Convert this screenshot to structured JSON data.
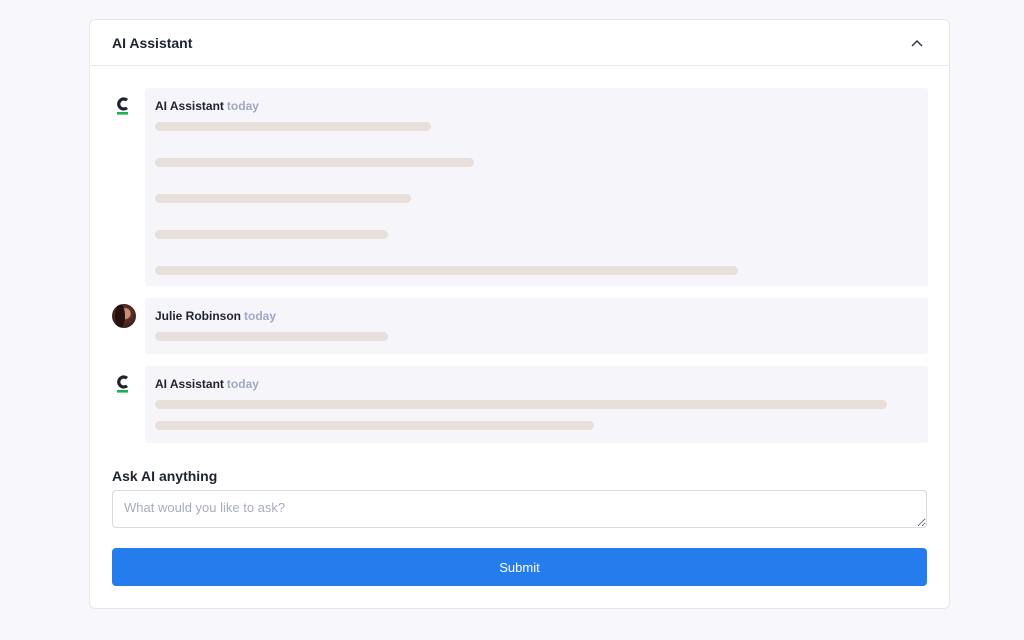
{
  "panel": {
    "title": "AI Assistant",
    "collapse_icon": "chevron-up-icon"
  },
  "messages": [
    {
      "author": "AI Assistant",
      "time": "today",
      "avatar": "brand-c-logo-icon",
      "type": "ai"
    },
    {
      "author": "Julie Robinson",
      "time": "today",
      "avatar": "user-avatar",
      "type": "user"
    },
    {
      "author": "AI Assistant",
      "time": "today",
      "avatar": "brand-c-logo-icon",
      "type": "ai"
    }
  ],
  "ask": {
    "label": "Ask AI anything",
    "placeholder": "What would you like to ask?",
    "value": ""
  },
  "submit": {
    "label": "Submit"
  },
  "colors": {
    "accent": "#247ced",
    "logo_dark": "#1f2330",
    "logo_green": "#1fb14f",
    "skeleton": "#e6dfdc",
    "bubble": "#f6f5fa",
    "timestamp": "#a0a8c4"
  }
}
